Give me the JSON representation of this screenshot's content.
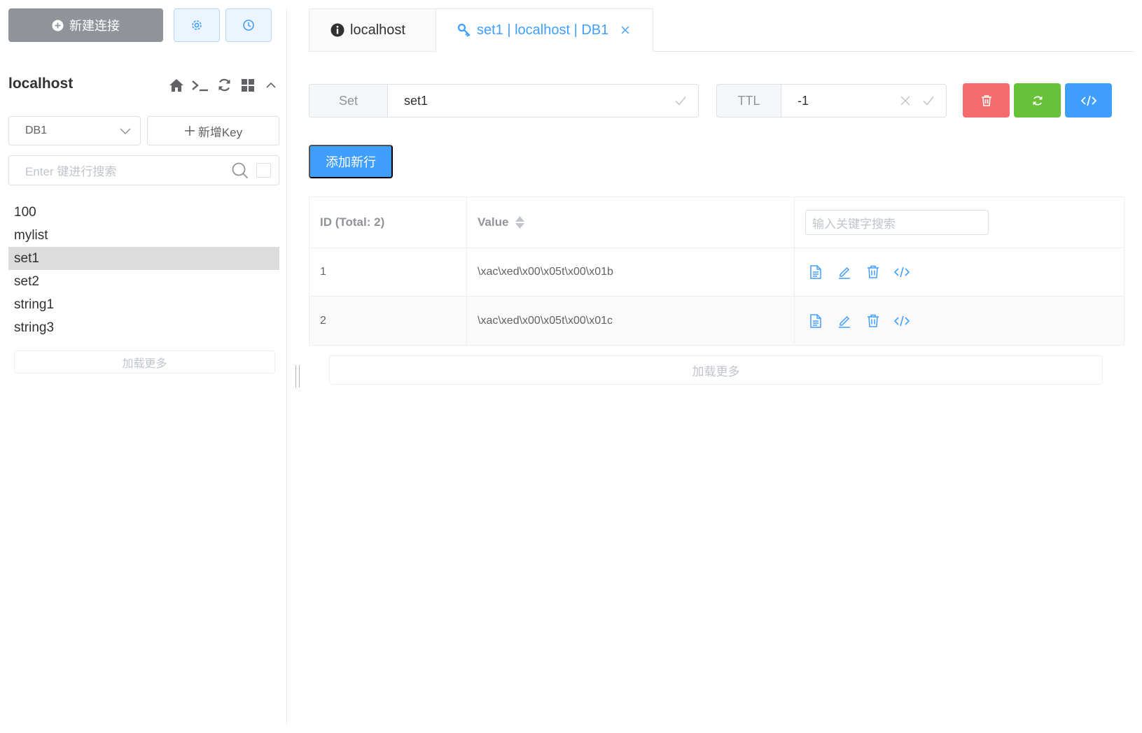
{
  "toolbar": {
    "new_connection_label": "新建连接"
  },
  "connection": {
    "name": "localhost"
  },
  "db_select": {
    "selected": "DB1"
  },
  "new_key_label": "新增Key",
  "key_search": {
    "placeholder": "Enter 键进行搜索"
  },
  "keys": [
    "100",
    "mylist",
    "set1",
    "set2",
    "string1",
    "string3"
  ],
  "active_key": "set1",
  "sidebar_load_more": "加载更多",
  "tabs": [
    {
      "label": "localhost",
      "icon": "info-icon"
    },
    {
      "label": "set1 | localhost | DB1",
      "icon": "key-icon"
    }
  ],
  "key_info": {
    "type_label": "Set",
    "key_name": "set1",
    "ttl_label": "TTL",
    "ttl_value": "-1"
  },
  "colors": {
    "primary": "#409eff",
    "danger": "#f56c6c",
    "success": "#67c23a",
    "active_row": "#dcdcdc"
  },
  "add_row_label": "添加新行",
  "table": {
    "col_id": "ID (Total: 2)",
    "col_value": "Value",
    "search_placeholder": "输入关键字搜索",
    "rows": [
      {
        "id": "1",
        "value": "\\xac\\xed\\x00\\x05t\\x00\\x01b"
      },
      {
        "id": "2",
        "value": "\\xac\\xed\\x00\\x05t\\x00\\x01c"
      }
    ]
  },
  "main_load_more": "加载更多"
}
